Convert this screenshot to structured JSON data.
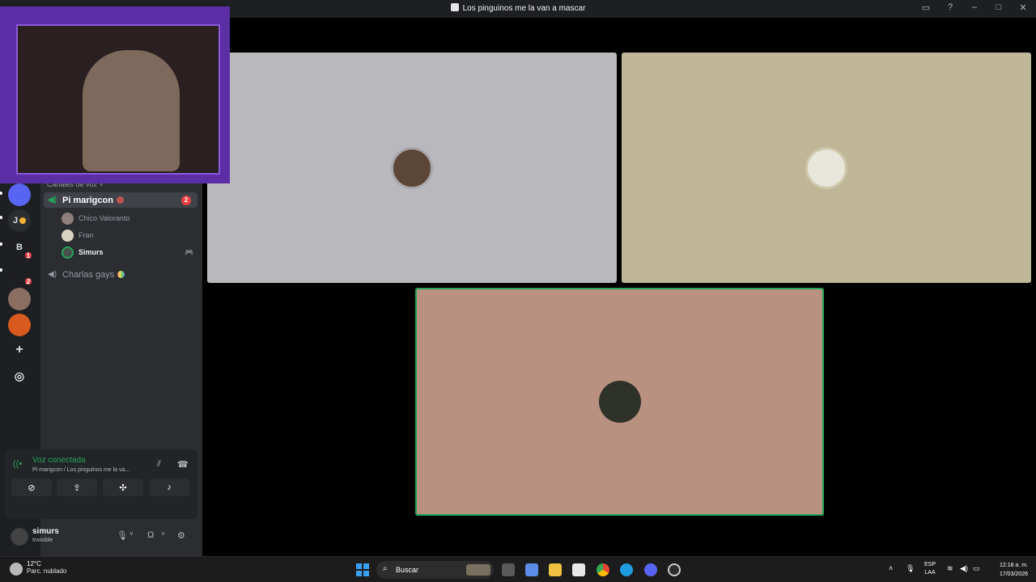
{
  "window": {
    "title": "Los pinguinos me la van a mascar",
    "controls": [
      "inbox-icon",
      "help-icon",
      "minimize-icon",
      "maximize-icon",
      "close-icon"
    ]
  },
  "rail": {
    "servers": [
      {
        "label": "",
        "name": "server-avatar-1"
      },
      {
        "label": "J",
        "name": "server-j"
      },
      {
        "label": "B",
        "name": "server-b",
        "badge": "1"
      },
      {
        "label": "",
        "name": "server-text-logo",
        "badge": "2"
      },
      {
        "label": "",
        "name": "server-avatar-2"
      },
      {
        "label": "",
        "name": "server-avatar-3"
      },
      {
        "label": "+",
        "name": "add-server"
      },
      {
        "label": "◎",
        "name": "discover"
      }
    ]
  },
  "channels": {
    "category": "Canales de voz ˅",
    "active_channel": {
      "name": "Pi marigcon",
      "count": "2"
    },
    "members": [
      "Chico Valoranto",
      "Fran",
      "Simurs"
    ],
    "other_channel": "Charlas gays"
  },
  "voice_panel": {
    "status": "Voz conectada",
    "subtitle": "Pi marigcon / Los pinguinos me la va..."
  },
  "user": {
    "name": "simurs",
    "status": "Invisible"
  },
  "tiles": [
    {
      "name": "participant-tile-1",
      "color": "#b9b8bc"
    },
    {
      "name": "participant-tile-2",
      "color": "#bfb597"
    },
    {
      "name": "participant-tile-3",
      "color": "#b99180",
      "speaking": true
    }
  ],
  "taskbar": {
    "weather_temp": "12°C",
    "weather_desc": "Parc. nublado",
    "search_label": "Buscar",
    "lang_1": "ESP",
    "lang_2": "LAA",
    "time": "12:18 a. m.",
    "date": "17/03/2026"
  },
  "colors": {
    "accent_green": "#23a55a",
    "badge_red": "#f23f43",
    "webcam_frame": "#5b2ea6"
  }
}
